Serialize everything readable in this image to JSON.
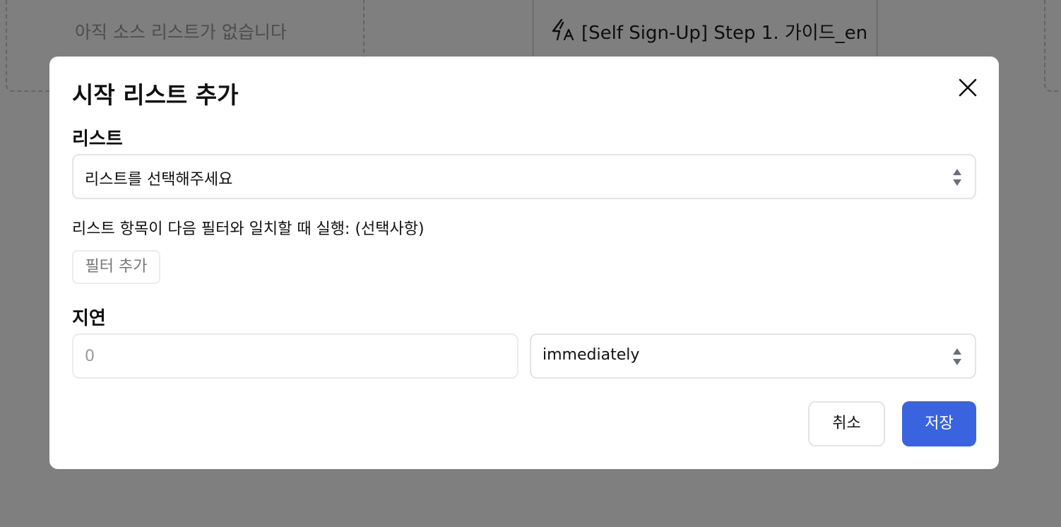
{
  "background": {
    "empty_source_text": "아직 소스 리스트가 없습니다",
    "card_title": "[Self Sign-Up] Step 1. 가이드_en",
    "card_icon": "zap-text-icon"
  },
  "modal": {
    "title": "시작 리스트 추가",
    "close_icon": "close-icon",
    "list_label": "리스트",
    "list_select_value": "리스트를 선택해주세요",
    "filter_hint": "리스트 항목이 다음 필터와 일치할 때 실행: (선택사항)",
    "add_filter_label": "필터 추가",
    "delay_label": "지연",
    "delay_placeholder": "0",
    "delay_unit_value": "immediately",
    "cancel_label": "취소",
    "save_label": "저장"
  },
  "colors": {
    "primary": "#3a63e0",
    "overlay": "rgba(0,0,0,0.5)"
  }
}
